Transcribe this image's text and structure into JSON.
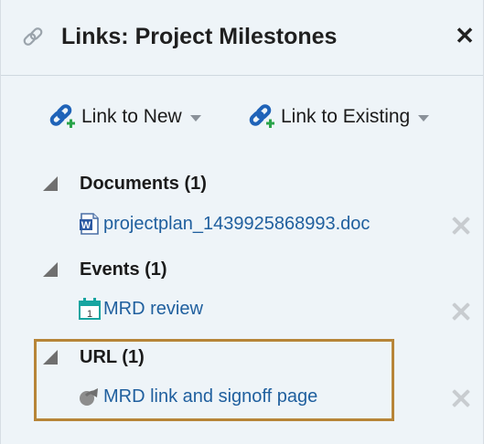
{
  "header": {
    "title": "Links: Project Milestones",
    "close_label": "✕"
  },
  "toolbar": {
    "link_new": "Link to New",
    "link_existing": "Link to Existing"
  },
  "sections": {
    "documents": {
      "label": "Documents (1)",
      "item": "projectplan_1439925868993.doc"
    },
    "events": {
      "label": "Events (1)",
      "item": "MRD review",
      "calendar_day": "1"
    },
    "url": {
      "label": "URL (1)",
      "item": "MRD link and signoff page"
    }
  },
  "icons": {
    "link": "link-icon",
    "add_link": "add-link-icon",
    "document": "word-doc-icon",
    "calendar": "calendar-icon",
    "url": "url-share-icon",
    "delete": "delete-icon"
  },
  "colors": {
    "link_text": "#1f5f9e",
    "highlight_border": "#b78538",
    "panel_bg": "#eef4f8"
  }
}
